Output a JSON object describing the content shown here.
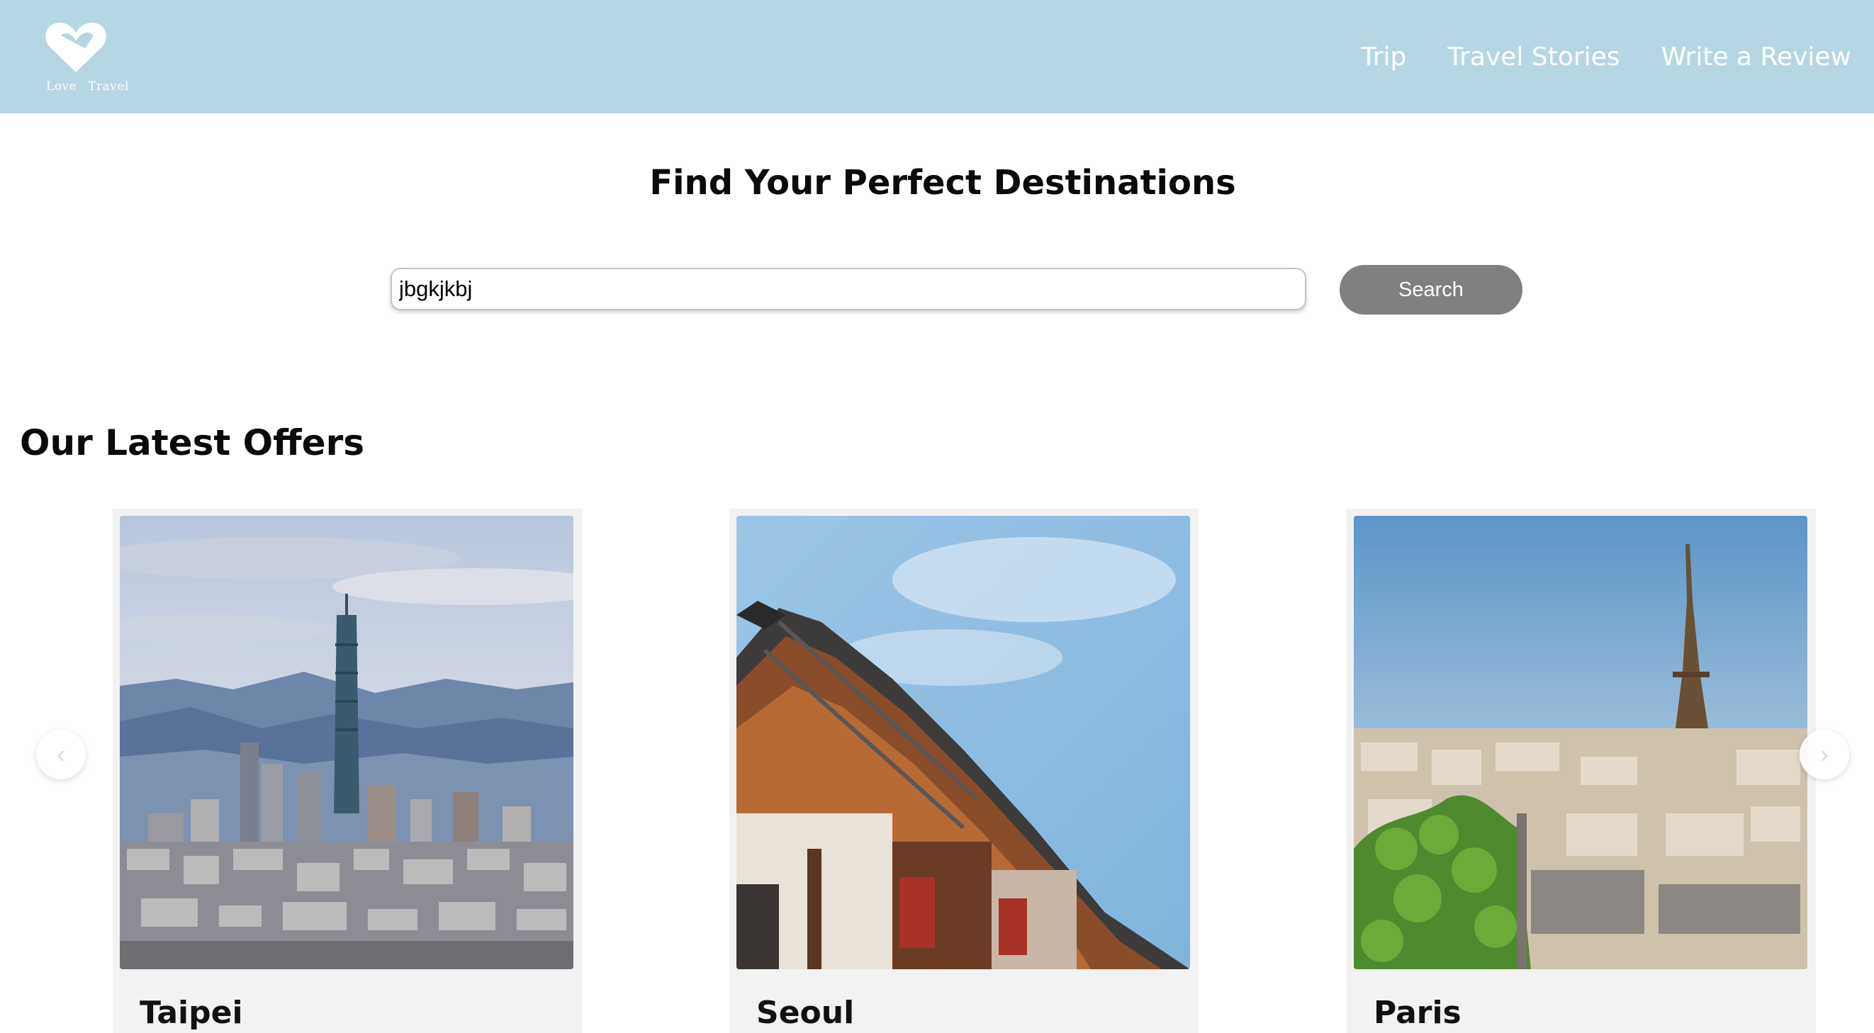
{
  "header": {
    "logo_text_1": "Love",
    "logo_text_2": "Travel",
    "nav": [
      "Trip",
      "Travel Stories",
      "Write a Review"
    ]
  },
  "hero": {
    "title": "Find Your Perfect Destinations",
    "search_value": "jbgkjkbj",
    "search_button": "Search"
  },
  "offers": {
    "title": "Our Latest Offers",
    "cards": [
      {
        "title": "Taipei",
        "image": "taipei-skyline-photo"
      },
      {
        "title": "Seoul",
        "image": "seoul-hanok-photo"
      },
      {
        "title": "Paris",
        "image": "paris-eiffel-photo"
      }
    ],
    "prev_icon": "chevron-left-icon",
    "next_icon": "chevron-right-icon"
  },
  "colors": {
    "header_bg": "#b5d7e3",
    "button_bg": "#808080",
    "card_bg": "#f2f2f2"
  }
}
